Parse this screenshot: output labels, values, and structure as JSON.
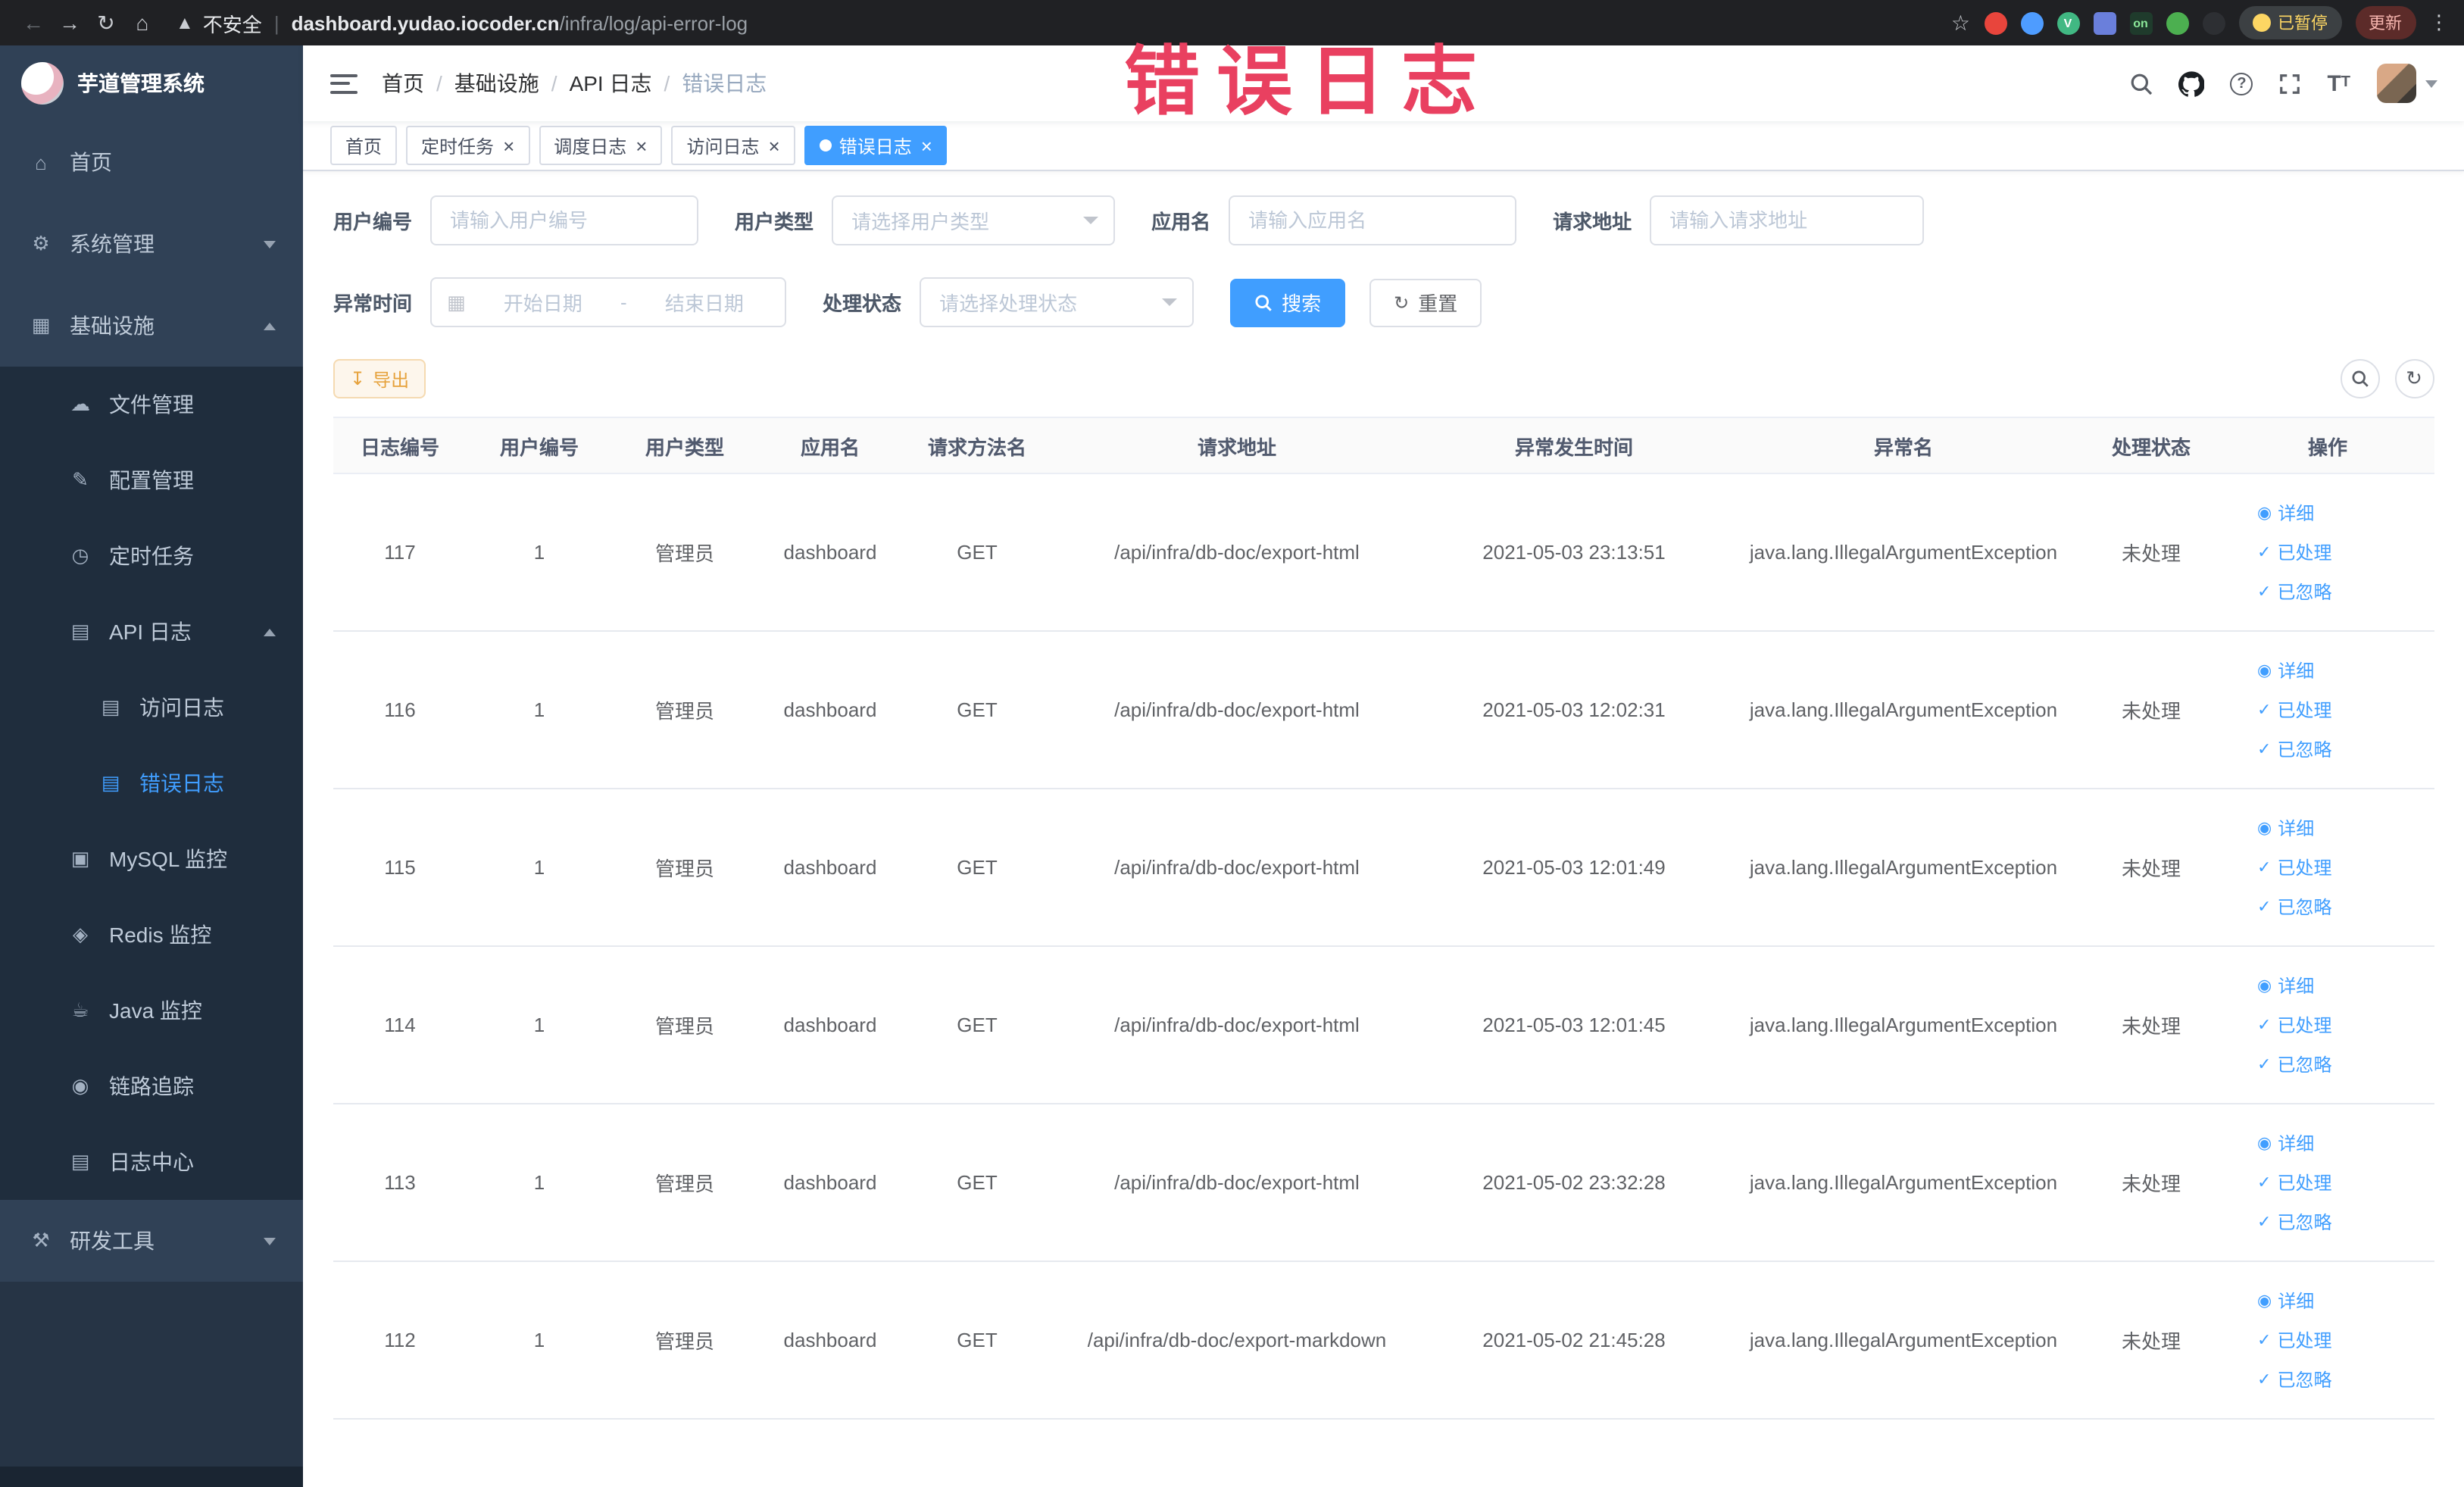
{
  "watermark": "错误日志",
  "colors": {
    "primary": "#409eff",
    "sidebar_bg": "#304156",
    "submenu_bg": "#1f2d3d",
    "warning": "#e6a23c",
    "watermark_red": "#e94060"
  },
  "browser": {
    "security_label": "不安全",
    "url_domain": "dashboard.yudao.iocoder.cn",
    "url_path": "/infra/log/api-error-log",
    "paused_badge": "已暂停",
    "update_button": "更新",
    "extensions": [
      {
        "name": "record-extension-icon",
        "color": "#e8453c",
        "shape": "circle",
        "text": ""
      },
      {
        "name": "water-drop-extension-icon",
        "color": "#4e9cff",
        "shape": "circle",
        "text": ""
      },
      {
        "name": "vue-devtools-extension-icon",
        "color": "#41b883",
        "shape": "circle",
        "text": "V"
      },
      {
        "name": "grid-extension-icon",
        "color": "#6a7fdb",
        "shape": "square",
        "text": ""
      },
      {
        "name": "on-badge-extension-icon",
        "color": "#1f3b2c",
        "shape": "square",
        "text": "on",
        "text_color": "#8ce99a"
      },
      {
        "name": "leaf-extension-icon",
        "color": "#4caf50",
        "shape": "circle",
        "text": ""
      },
      {
        "name": "paw-extension-icon",
        "color": "#2d2f33",
        "shape": "circle",
        "text": ""
      }
    ]
  },
  "sidebar": {
    "logo_title": "芋道管理系统",
    "items": [
      {
        "key": "home",
        "label": "首页",
        "icon": "home-icon",
        "depth": 0
      },
      {
        "key": "system-management",
        "label": "系统管理",
        "icon": "gear-icon",
        "depth": 0,
        "chevron": "down"
      },
      {
        "key": "infrastructure",
        "label": "基础设施",
        "icon": "infra-icon",
        "depth": 0,
        "chevron": "up"
      },
      {
        "key": "file-management",
        "label": "文件管理",
        "icon": "cloud-icon",
        "depth": 1
      },
      {
        "key": "config-management",
        "label": "配置管理",
        "icon": "edit-icon",
        "depth": 1
      },
      {
        "key": "scheduled-tasks",
        "label": "定时任务",
        "icon": "clock-icon",
        "depth": 1
      },
      {
        "key": "api-logs",
        "label": "API 日志",
        "icon": "log-icon",
        "depth": 1,
        "chevron": "up"
      },
      {
        "key": "access-log",
        "label": "访问日志",
        "icon": "doc-icon",
        "depth": 2
      },
      {
        "key": "error-log",
        "label": "错误日志",
        "icon": "doc-icon",
        "depth": 2,
        "active": true
      },
      {
        "key": "mysql-monitor",
        "label": "MySQL 监控",
        "icon": "monitor-icon",
        "depth": 1
      },
      {
        "key": "redis-monitor",
        "label": "Redis 监控",
        "icon": "redis-icon",
        "depth": 1
      },
      {
        "key": "java-monitor",
        "label": "Java 监控",
        "icon": "java-icon",
        "depth": 1
      },
      {
        "key": "link-tracing",
        "label": "链路追踪",
        "icon": "eye-icon",
        "depth": 1
      },
      {
        "key": "log-center",
        "label": "日志中心",
        "icon": "log-icon",
        "depth": 1
      },
      {
        "key": "dev-tools",
        "label": "研发工具",
        "icon": "tools-icon",
        "depth": 0,
        "chevron": "down"
      }
    ]
  },
  "header": {
    "breadcrumb": [
      "首页",
      "基础设施",
      "API 日志",
      "错误日志"
    ]
  },
  "tabs": [
    {
      "label": "首页",
      "closable": false,
      "active": false
    },
    {
      "label": "定时任务",
      "closable": true,
      "active": false
    },
    {
      "label": "调度日志",
      "closable": true,
      "active": false
    },
    {
      "label": "访问日志",
      "closable": true,
      "active": false
    },
    {
      "label": "错误日志",
      "closable": true,
      "active": true
    }
  ],
  "filters": {
    "user_id": {
      "label": "用户编号",
      "placeholder": "请输入用户编号"
    },
    "user_type": {
      "label": "用户类型",
      "placeholder": "请选择用户类型"
    },
    "app_name": {
      "label": "应用名",
      "placeholder": "请输入应用名"
    },
    "request_url": {
      "label": "请求地址",
      "placeholder": "请输入请求地址"
    },
    "exception_time": {
      "label": "异常时间",
      "start_placeholder": "开始日期",
      "separator": "-",
      "end_placeholder": "结束日期"
    },
    "process_status": {
      "label": "处理状态",
      "placeholder": "请选择处理状态"
    },
    "search_button": "搜索",
    "reset_button": "重置"
  },
  "toolbar": {
    "export_button": "导出"
  },
  "table": {
    "columns": [
      "日志编号",
      "用户编号",
      "用户类型",
      "应用名",
      "请求方法名",
      "请求地址",
      "异常发生时间",
      "异常名",
      "处理状态",
      "操作"
    ],
    "column_keys": [
      "log_id",
      "user_id",
      "user_type",
      "app_name",
      "method",
      "url",
      "time",
      "exception",
      "status",
      "actions"
    ],
    "rows": [
      {
        "log_id": "117",
        "user_id": "1",
        "user_type": "管理员",
        "app_name": "dashboard",
        "method": "GET",
        "url": "/api/infra/db-doc/export-html",
        "time": "2021-05-03 23:13:51",
        "exception": "java.lang.IllegalArgumentException",
        "status": "未处理"
      },
      {
        "log_id": "116",
        "user_id": "1",
        "user_type": "管理员",
        "app_name": "dashboard",
        "method": "GET",
        "url": "/api/infra/db-doc/export-html",
        "time": "2021-05-03 12:02:31",
        "exception": "java.lang.IllegalArgumentException",
        "status": "未处理"
      },
      {
        "log_id": "115",
        "user_id": "1",
        "user_type": "管理员",
        "app_name": "dashboard",
        "method": "GET",
        "url": "/api/infra/db-doc/export-html",
        "time": "2021-05-03 12:01:49",
        "exception": "java.lang.IllegalArgumentException",
        "status": "未处理"
      },
      {
        "log_id": "114",
        "user_id": "1",
        "user_type": "管理员",
        "app_name": "dashboard",
        "method": "GET",
        "url": "/api/infra/db-doc/export-html",
        "time": "2021-05-03 12:01:45",
        "exception": "java.lang.IllegalArgumentException",
        "status": "未处理"
      },
      {
        "log_id": "113",
        "user_id": "1",
        "user_type": "管理员",
        "app_name": "dashboard",
        "method": "GET",
        "url": "/api/infra/db-doc/export-html",
        "time": "2021-05-02 23:32:28",
        "exception": "java.lang.IllegalArgumentException",
        "status": "未处理"
      },
      {
        "log_id": "112",
        "user_id": "1",
        "user_type": "管理员",
        "app_name": "dashboard",
        "method": "GET",
        "url": "/api/infra/db-doc/export-markdown",
        "time": "2021-05-02 21:45:28",
        "exception": "java.lang.IllegalArgumentException",
        "status": "未处理"
      }
    ],
    "row_actions": [
      {
        "name": "detail-link",
        "icon": "eye-icon",
        "label": "详细"
      },
      {
        "name": "processed-link",
        "icon": "check-icon",
        "label": "已处理"
      },
      {
        "name": "ignored-link",
        "icon": "check-icon",
        "label": "已忽略"
      }
    ]
  }
}
